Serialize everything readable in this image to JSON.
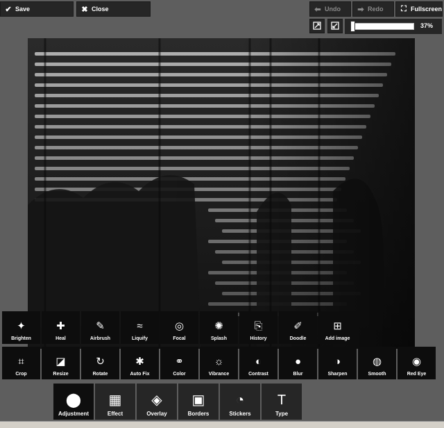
{
  "toolbar": {
    "save_label": "Save",
    "close_label": "Close",
    "undo_label": "Undo",
    "redo_label": "Redo",
    "fullscreen_label": "Fullscreen",
    "zoom_value": 0.37,
    "zoom_text": "37%"
  },
  "icons": {
    "save": "check-icon",
    "close": "close-icon",
    "undo": "arrow-left-icon",
    "redo": "arrow-right-icon",
    "fullscreen": "expand-icon",
    "fit": "fit-screen-icon",
    "actual_size": "actual-size-icon"
  },
  "tools_row1": [
    {
      "label": "Brighten",
      "icon": "sparkle-icon"
    },
    {
      "label": "Heal",
      "icon": "bandage-icon"
    },
    {
      "label": "Airbrush",
      "icon": "airbrush-icon"
    },
    {
      "label": "Liquify",
      "icon": "wave-icon"
    },
    {
      "label": "Focal",
      "icon": "target-icon"
    },
    {
      "label": "Splash",
      "icon": "splash-icon"
    },
    {
      "label": "History",
      "icon": "history-icon"
    },
    {
      "label": "Doodle",
      "icon": "doodle-icon"
    },
    {
      "label": "Add image",
      "icon": "add-image-icon"
    }
  ],
  "tools_row2": [
    {
      "label": "Crop",
      "icon": "crop-icon"
    },
    {
      "label": "Resize",
      "icon": "resize-icon"
    },
    {
      "label": "Rotate",
      "icon": "rotate-icon"
    },
    {
      "label": "Auto Fix",
      "icon": "auto-fix-icon"
    },
    {
      "label": "Color",
      "icon": "color-icon"
    },
    {
      "label": "Vibrance",
      "icon": "vibrance-icon"
    },
    {
      "label": "Contrast",
      "icon": "contrast-icon"
    },
    {
      "label": "Blur",
      "icon": "blur-icon"
    },
    {
      "label": "Sharpen",
      "icon": "sharpen-icon"
    },
    {
      "label": "Smooth",
      "icon": "smooth-icon"
    },
    {
      "label": "Red Eye",
      "icon": "eye-icon"
    }
  ],
  "categories": [
    {
      "label": "Adjustment",
      "icon": "adjustment-icon",
      "active": true
    },
    {
      "label": "Effect",
      "icon": "film-icon",
      "active": false
    },
    {
      "label": "Overlay",
      "icon": "layers-icon",
      "active": false
    },
    {
      "label": "Borders",
      "icon": "border-icon",
      "active": false
    },
    {
      "label": "Stickers",
      "icon": "sticker-icon",
      "active": false
    },
    {
      "label": "Type",
      "icon": "type-icon",
      "active": false
    }
  ]
}
